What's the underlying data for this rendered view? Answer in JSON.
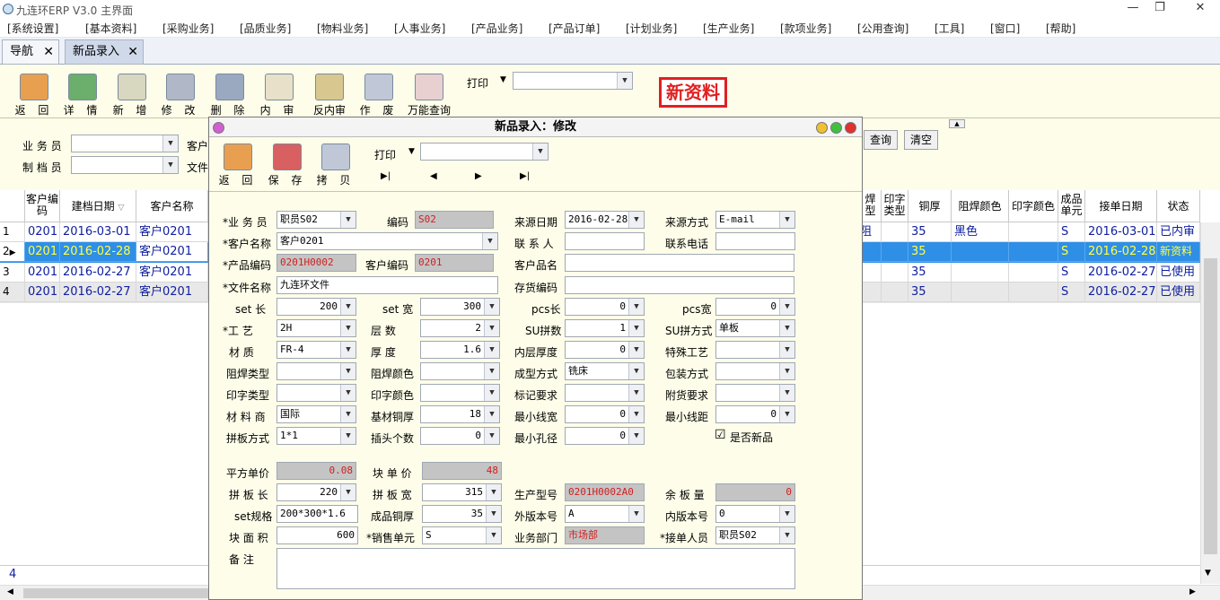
{
  "window": {
    "title": "九连环ERP V3.0 主界面"
  },
  "menu": [
    "[系统设置]",
    "[基本资料]",
    "[采购业务]",
    "[品质业务]",
    "[物料业务]",
    "[人事业务]",
    "[产品业务]",
    "[产品订单]",
    "[计划业务]",
    "[生产业务]",
    "[款项业务]",
    "[公用查询]",
    "[工具]",
    "[窗口]",
    "[帮助]"
  ],
  "tabs": [
    {
      "label": "导航"
    },
    {
      "label": "新品录入"
    }
  ],
  "toolbar": {
    "buttons": [
      "返 回",
      "详 情",
      "新 增",
      "修 改",
      "删 除",
      "内 审",
      "反内审",
      "作 废",
      "万能查询"
    ],
    "print_label": "打印",
    "badge": "新资料"
  },
  "filter": {
    "salesman_label": "业 务 员",
    "archivist_label": "制 档 员",
    "customer_label": "客户",
    "file_label": "文件",
    "query_btn": "查询",
    "clear_btn": "清空"
  },
  "grid": {
    "headers": [
      "客户编码",
      "建档日期",
      "客户名称",
      "焊型",
      "印字类型",
      "铜厚",
      "阻焊颜色",
      "印字颜色",
      "成品单元",
      "接单日期",
      "状态"
    ],
    "rows": [
      {
        "no": "1",
        "code": "0201",
        "date": "2016-03-01",
        "cust": "客户0201",
        "hx": "阻",
        "cu": "35",
        "mask": "黑色",
        "unit": "S",
        "order": "2016-03-01",
        "status": "已内审"
      },
      {
        "no": "2",
        "code": "0201",
        "date": "2016-02-28",
        "cust": "客户0201",
        "hx": "",
        "cu": "35",
        "mask": "",
        "unit": "S",
        "order": "2016-02-28",
        "status": "新资料"
      },
      {
        "no": "3",
        "code": "0201",
        "date": "2016-02-27",
        "cust": "客户0201",
        "hx": "",
        "cu": "35",
        "mask": "",
        "unit": "S",
        "order": "2016-02-27",
        "status": "已使用"
      },
      {
        "no": "4",
        "code": "0201",
        "date": "2016-02-27",
        "cust": "客户0201",
        "hx": "",
        "cu": "35",
        "mask": "",
        "unit": "S",
        "order": "2016-02-27",
        "status": "已使用"
      }
    ],
    "footer_count": "4"
  },
  "dialog": {
    "title": "新品录入：修改",
    "buttons": [
      "返 回",
      "保 存",
      "拷 贝"
    ],
    "print_label": "打印",
    "fields": {
      "salesman": {
        "label": "*业 务 员",
        "value": "职员S02"
      },
      "code": {
        "label": "编码",
        "value": "S02"
      },
      "src_date": {
        "label": "来源日期",
        "value": "2016-02-28"
      },
      "src_way": {
        "label": "来源方式",
        "value": "E-mail"
      },
      "cust_name": {
        "label": "*客户名称",
        "value": "客户0201"
      },
      "contact": {
        "label": "联 系 人",
        "value": ""
      },
      "phone": {
        "label": "联系电话",
        "value": ""
      },
      "prod_code": {
        "label": "*产品编码",
        "value": "0201H0002"
      },
      "cust_code": {
        "label": "客户编码",
        "value": "0201"
      },
      "cust_pn": {
        "label": "客户品名",
        "value": ""
      },
      "file_name": {
        "label": "*文件名称",
        "value": "九连环文件"
      },
      "stock_code": {
        "label": "存货编码",
        "value": ""
      },
      "set_len": {
        "label": "set 长",
        "value": "200"
      },
      "set_wid": {
        "label": "set 宽",
        "value": "300"
      },
      "pcs_len": {
        "label": "pcs长",
        "value": "0"
      },
      "pcs_wid": {
        "label": "pcs宽",
        "value": "0"
      },
      "process": {
        "label": "*工    艺",
        "value": "2H"
      },
      "layers": {
        "label": "层    数",
        "value": "2"
      },
      "su_pcs": {
        "label": "SU拼数",
        "value": "1"
      },
      "su_way": {
        "label": "SU拼方式",
        "value": "单板"
      },
      "material": {
        "label": "材    质",
        "value": "FR-4"
      },
      "thickness": {
        "label": "厚    度",
        "value": "1.6"
      },
      "inner_thk": {
        "label": "内层厚度",
        "value": "0"
      },
      "special": {
        "label": "特殊工艺",
        "value": ""
      },
      "mask_type": {
        "label": "阻焊类型",
        "value": ""
      },
      "mask_color": {
        "label": "阻焊颜色",
        "value": ""
      },
      "forming": {
        "label": "成型方式",
        "value": "铣床"
      },
      "packing": {
        "label": "包装方式",
        "value": ""
      },
      "print_type": {
        "label": "印字类型",
        "value": ""
      },
      "print_color": {
        "label": "印字颜色",
        "value": ""
      },
      "mark_req": {
        "label": "标记要求",
        "value": ""
      },
      "ship_req": {
        "label": "附货要求",
        "value": ""
      },
      "supplier": {
        "label": "材 料 商",
        "value": "国际"
      },
      "base_cu": {
        "label": "基材铜厚",
        "value": "18"
      },
      "min_lw": {
        "label": "最小线宽",
        "value": "0"
      },
      "min_ls": {
        "label": "最小线距",
        "value": "0"
      },
      "panel_way": {
        "label": "拼板方式",
        "value": "1*1"
      },
      "plugs": {
        "label": "插头个数",
        "value": "0"
      },
      "min_hole": {
        "label": "最小孔径",
        "value": "0"
      },
      "is_new": {
        "label": "是否新品",
        "checked": "☑"
      },
      "sq_price": {
        "label": "平方单价",
        "value": "0.08"
      },
      "blk_price": {
        "label": "块 单 价",
        "value": "48"
      },
      "pnl_len": {
        "label": "拼 板 长",
        "value": "220"
      },
      "pnl_wid": {
        "label": "拼 板 宽",
        "value": "315"
      },
      "prod_model": {
        "label": "生产型号",
        "value": "0201H0002A0"
      },
      "remain": {
        "label": "余 板 量",
        "value": "0"
      },
      "set_spec": {
        "label": "set规格",
        "value": "200*300*1.6"
      },
      "fin_cu": {
        "label": "成品铜厚",
        "value": "35"
      },
      "outer_ver": {
        "label": "外版本号",
        "value": "A"
      },
      "inner_ver": {
        "label": "内版本号",
        "value": "0"
      },
      "blk_area": {
        "label": "块 面 积",
        "value": "600"
      },
      "sale_unit": {
        "label": "*销售单元",
        "value": "S"
      },
      "dept": {
        "label": "业务部门",
        "value": "市场部"
      },
      "receiver": {
        "label": "*接单人员",
        "value": "职员S02"
      },
      "remark": {
        "label": "备    注",
        "value": ""
      }
    }
  }
}
